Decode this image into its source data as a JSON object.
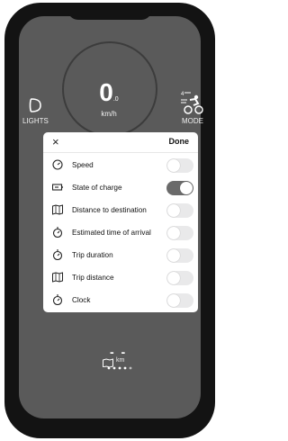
{
  "dashboard": {
    "speed": "0",
    "speed_decimal": ".0",
    "speed_unit": "km/h",
    "lights_label": "LIGHTS",
    "mode_label": "MODE",
    "mode_level": "4",
    "bottom_value": "- -",
    "bottom_unit": "km"
  },
  "settings_sheet": {
    "close_symbol": "×",
    "done_label": "Done",
    "items": [
      {
        "label": "Speed",
        "icon": "speedometer-icon",
        "enabled": false
      },
      {
        "label": "State of charge",
        "icon": "battery-icon",
        "enabled": true
      },
      {
        "label": "Distance to destination",
        "icon": "map-icon",
        "enabled": false
      },
      {
        "label": "Estimated time of arrival",
        "icon": "stopwatch-icon",
        "enabled": false
      },
      {
        "label": "Trip duration",
        "icon": "stopwatch-icon",
        "enabled": false
      },
      {
        "label": "Trip distance",
        "icon": "map-icon",
        "enabled": false
      },
      {
        "label": "Clock",
        "icon": "stopwatch-icon",
        "enabled": false
      }
    ]
  },
  "colors": {
    "screen_bg": "#5a5a5a",
    "toggle_on": "#6a6a6a",
    "toggle_off": "#e9e9ea"
  }
}
